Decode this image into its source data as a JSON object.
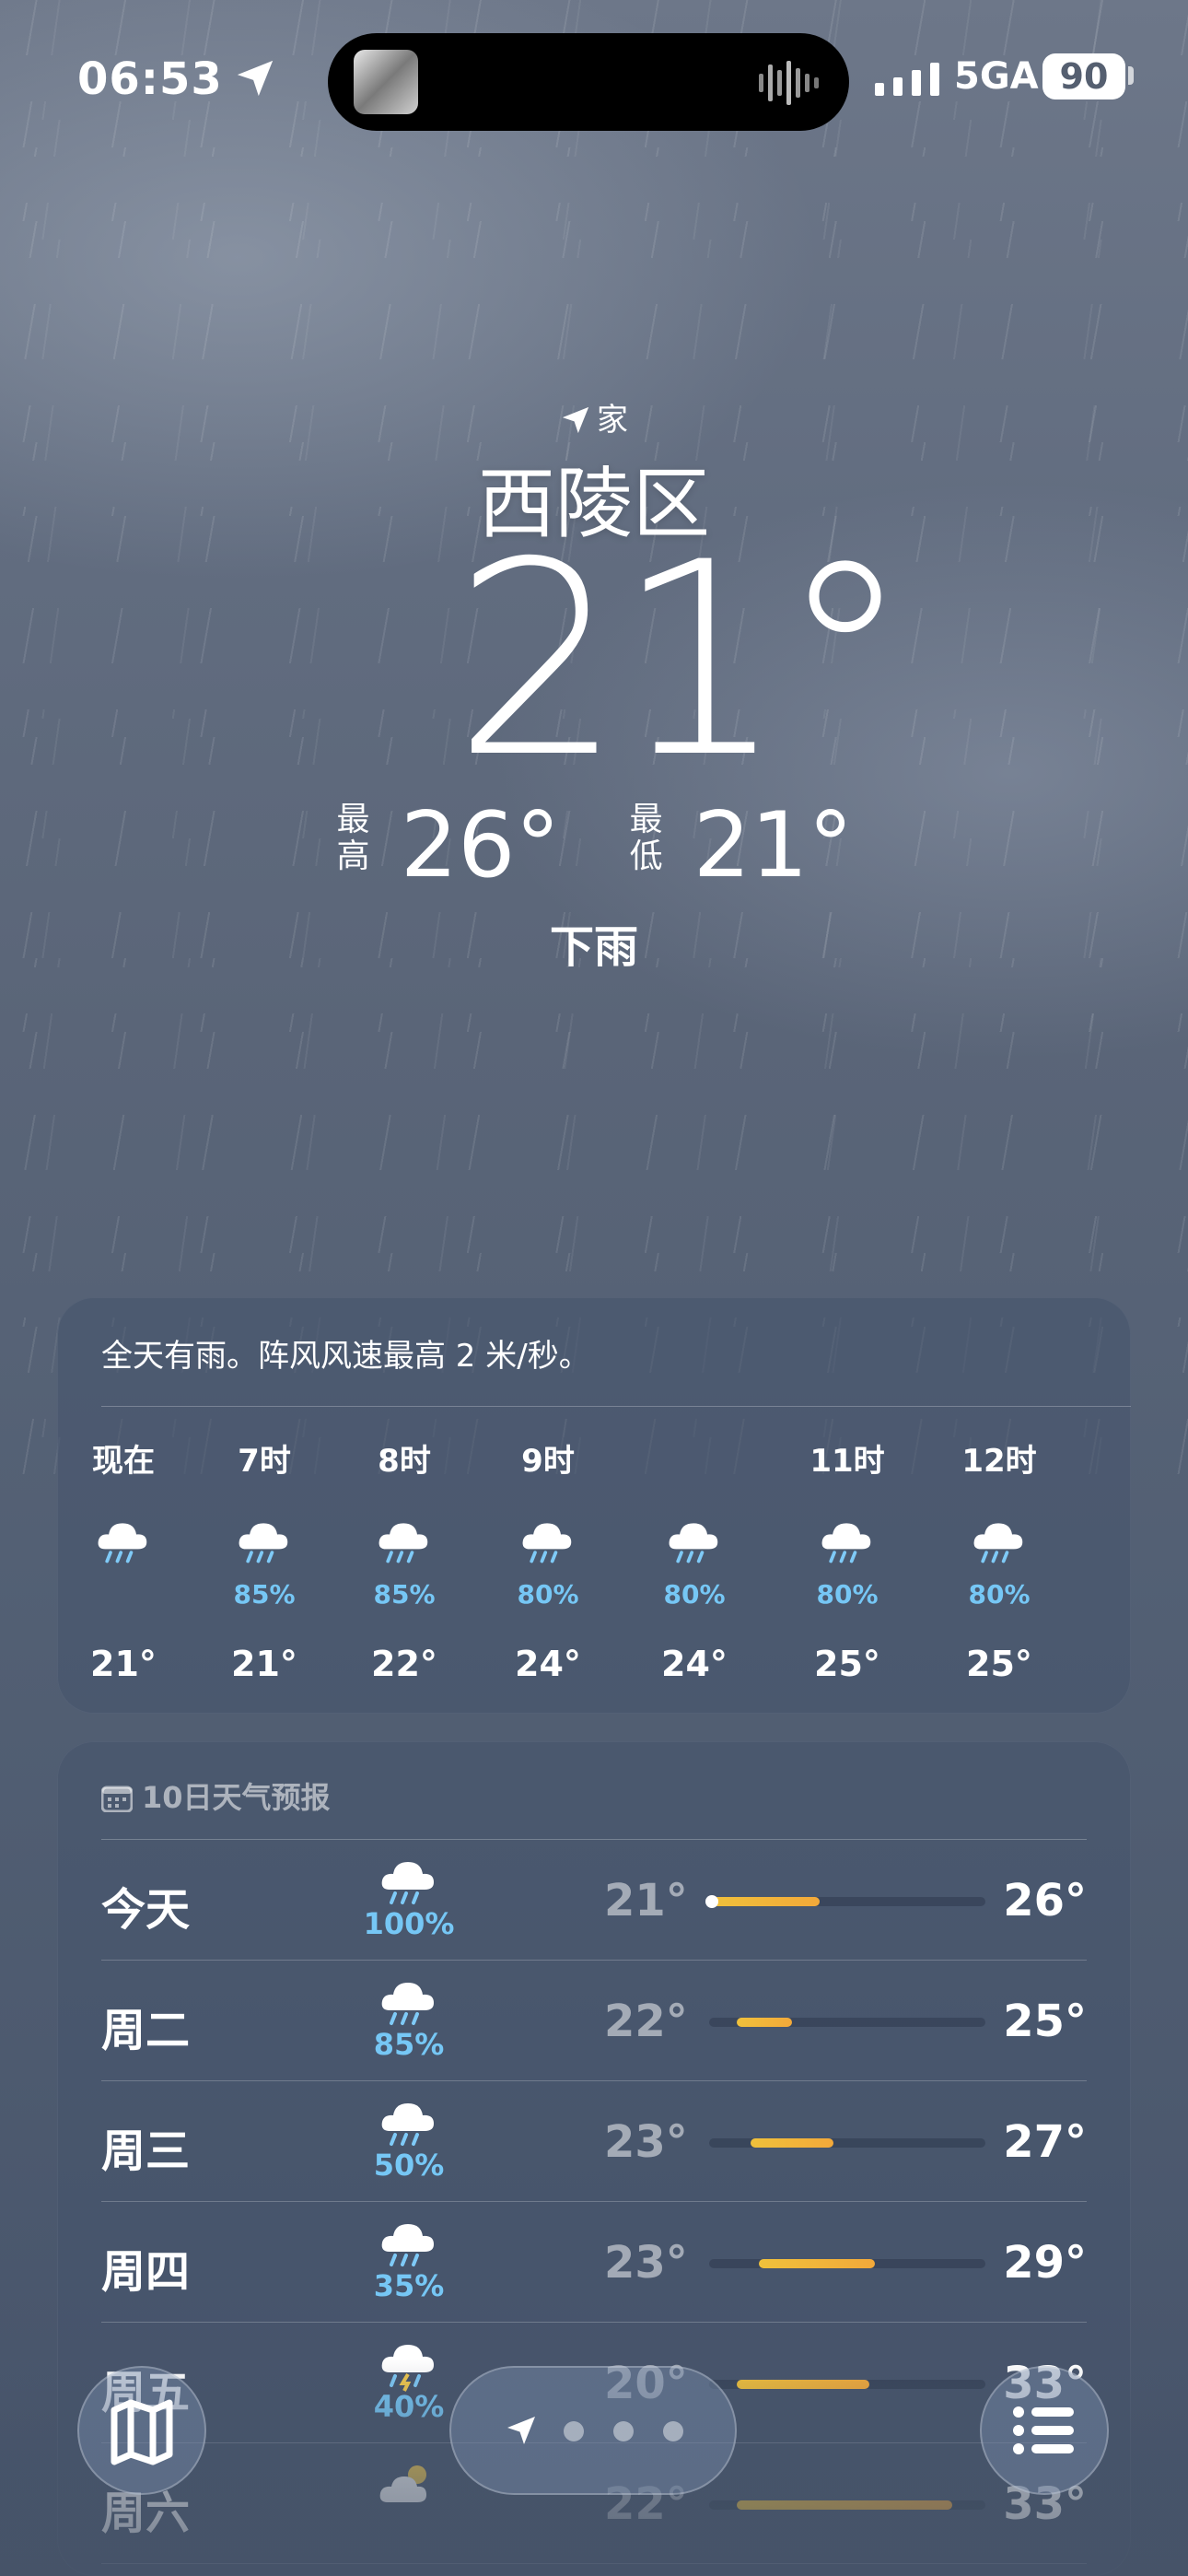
{
  "status_bar": {
    "time": "06:53",
    "network": "5GA",
    "battery": "90",
    "icons": [
      "location-arrow-icon",
      "signal-bars-icon"
    ]
  },
  "header": {
    "home_label": "家",
    "city": "西陵区",
    "current_temp": "21°",
    "high_label": "最高",
    "high": "26°",
    "low_label": "最低",
    "low": "21°",
    "condition": "下雨"
  },
  "hourly": {
    "summary": "全天有雨。阵风风速最高 2 米/秒。",
    "hours": [
      {
        "label": "现在",
        "pop": "",
        "temp": "21°",
        "icon": "rain-icon"
      },
      {
        "label": "7时",
        "pop": "85%",
        "temp": "21°",
        "icon": "rain-icon"
      },
      {
        "label": "8时",
        "pop": "85%",
        "temp": "22°",
        "icon": "rain-icon"
      },
      {
        "label": "9时",
        "pop": "80%",
        "temp": "24°",
        "icon": "rain-icon"
      },
      {
        "label": "",
        "pop": "80%",
        "temp": "24°",
        "icon": "rain-icon"
      },
      {
        "label": "11时",
        "pop": "80%",
        "temp": "25°",
        "icon": "rain-icon"
      },
      {
        "label": "12时",
        "pop": "80%",
        "temp": "25°",
        "icon": "rain-icon"
      }
    ]
  },
  "daily": {
    "title": "10日天气预报",
    "days": [
      {
        "name": "今天",
        "pop": "100%",
        "low": "21°",
        "high": "26°",
        "icon": "rain-icon",
        "range_start": 0.0,
        "range_end": 0.4
      },
      {
        "name": "周二",
        "pop": "85%",
        "low": "22°",
        "high": "25°",
        "icon": "rain-icon",
        "range_start": 0.1,
        "range_end": 0.3
      },
      {
        "name": "周三",
        "pop": "50%",
        "low": "23°",
        "high": "27°",
        "icon": "rain-icon",
        "range_start": 0.15,
        "range_end": 0.45
      },
      {
        "name": "周四",
        "pop": "35%",
        "low": "23°",
        "high": "29°",
        "icon": "rain-icon",
        "range_start": 0.18,
        "range_end": 0.6
      },
      {
        "name": "周五",
        "pop": "40%",
        "low": "20°",
        "high": "33°",
        "icon": "thunderstorm-icon",
        "range_start": 0.1,
        "range_end": 0.58
      },
      {
        "name": "周六",
        "pop": "",
        "low": "22°",
        "high": "33°",
        "icon": "partly-sunny-icon",
        "range_start": 0.1,
        "range_end": 0.88
      }
    ]
  },
  "toolbar": {
    "icons": [
      "map-icon",
      "location-arrow-icon",
      "list-icon"
    ]
  }
}
